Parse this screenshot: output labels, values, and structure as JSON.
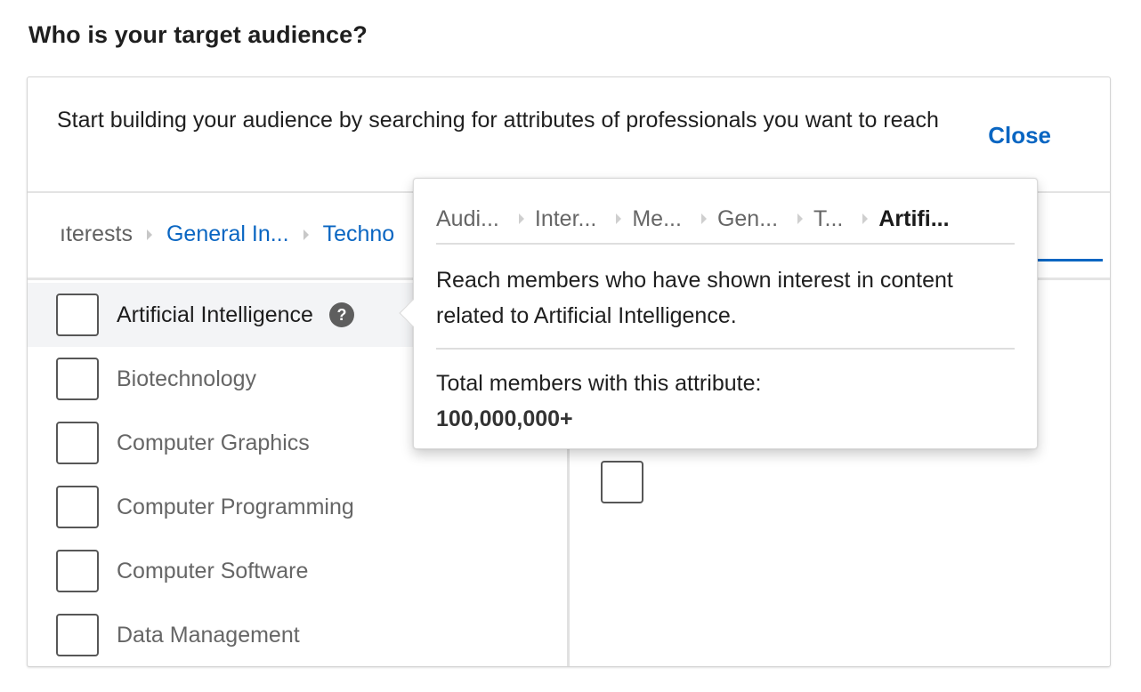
{
  "page": {
    "title": "Who is your target audience?"
  },
  "card": {
    "intro": "Start building your audience by searching for attributes of professionals you want to reach",
    "close_label": "Close"
  },
  "breadcrumb": {
    "items": [
      {
        "label": "ıterests",
        "link": false
      },
      {
        "label": "General In...",
        "link": true
      },
      {
        "label": "Techno",
        "link": true
      }
    ]
  },
  "list": {
    "items": [
      {
        "label": "Artificial Intelligence",
        "checked": false,
        "active": true
      },
      {
        "label": "Biotechnology",
        "checked": false,
        "active": false
      },
      {
        "label": "Computer Graphics",
        "checked": false,
        "active": false
      },
      {
        "label": "Computer Programming",
        "checked": false,
        "active": false
      },
      {
        "label": "Computer Software",
        "checked": false,
        "active": false
      },
      {
        "label": "Data Management",
        "checked": false,
        "active": false
      }
    ]
  },
  "icons": {
    "help": "?"
  },
  "tooltip": {
    "path": [
      {
        "label": "Audi...",
        "current": false
      },
      {
        "label": "Inter...",
        "current": false
      },
      {
        "label": "Me...",
        "current": false
      },
      {
        "label": "Gen...",
        "current": false
      },
      {
        "label": "T...",
        "current": false
      },
      {
        "label": "Artifi...",
        "current": true
      }
    ],
    "description": "Reach members who have shown interest in content related to Artificial Intelligence.",
    "total_label": "Total members with this attribute:",
    "total_count": "100,000,000+"
  },
  "colors": {
    "accent": "#0a66c2",
    "text": "#1f1f1f",
    "muted": "#666666",
    "active_row": "#f3f4f6"
  }
}
